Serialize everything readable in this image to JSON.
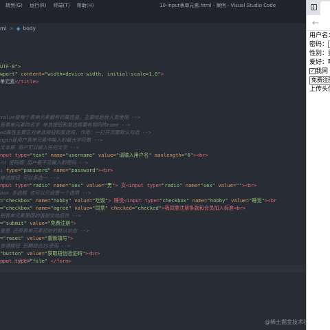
{
  "window": {
    "menu": [
      "转到(G)",
      "运行(R)",
      "终端(T)",
      "帮助(H)"
    ],
    "title": "10-input表单元素.html - 案例 - Visual Studio Code"
  },
  "breadcrumb": {
    "file": "ml",
    "separator": ">",
    "node": "body"
  },
  "code": {
    "l1": "UTF-8\">",
    "l2a": "wport\"",
    "l2b": "content=",
    "l2c": "\"width=device-width, initial-scale=1.0\"",
    "l2d": ">",
    "l3a": "单元素",
    "l3b": "</title>",
    "c1": "value是每个表单元素都有的属性值，主要给后台人员使用 -->",
    "c2": "是表单元素的名字 单选按钮和复选框要有相同的name -->",
    "c3": "ed属性主要正对单选按钮和复选框，作用：一打开页面默认勾选 -->",
    "c4": "ngth是用户表单元素中输入的最大字符数 -->",
    "c5": "文本框 用户可以输入任何文字 -->",
    "u1": "nput type=",
    "u2": "\"text\"",
    "u3": " name=",
    "u4": "\"username\"",
    "u5": " value=",
    "u6": "\"请输入用户名\"",
    "u7": " maxlength=",
    "u8": "\"6\"",
    "u9": "><br>",
    "c6": "rd 密码框 用户看不见输入的密码 -->",
    "p1": ": type=",
    "p2": "\"password\"",
    "p3": " name=",
    "p4": "\"password\"",
    "p5": "><br>",
    "c7": "单选按钮 可以多选一 -->",
    "r1": "nput type=",
    "r2": "\"radio\"",
    "r3": " name=",
    "r4": "\"sex\"",
    "r5": " value=",
    "r6": "\"男\"",
    "r7": "> 女<input type=",
    "r8": "\"radio\"",
    "r9": " name=",
    "r10": "\"sex\"",
    "r11": " value=",
    "r12": "\"\"",
    "r13": "><br>",
    "c8": "box 多选框 也可以只设置一个选项 -->",
    "k1": "=\"checkbox\"",
    "k2": " name=",
    "k3": "\"hobby\"",
    "k4": " value=",
    "k5": "\"吃饭\"",
    "k6": "> 睡觉<input type=",
    "k7": "\"checkbox\"",
    "k8": " name=",
    "k9": "\"hobby\"",
    "k10": " value=",
    "k11": "\"睡觉\"",
    "k12": "><br",
    "a1": "=\"checkbox\"",
    "a2": " name=",
    "a3": "\"agree\"",
    "a4": " value=",
    "a5": "\"同意\"",
    "a6": " checked=",
    "a7": "\"checked\"",
    "a8": ">我同意注册条款和会员加入标准<br>",
    "c9": "把表单元素里面的值提交给后台 -->",
    "s1": "=\"submit\"",
    "s2": " value=",
    "s3": "\"免费注册\"",
    "s4": ">",
    "c10": "重置 还原表单元素初始的默认状态 -->",
    "e1": "=\"reset\"",
    "e2": " value=",
    "e3": "\"重新填写\"",
    "e4": ">",
    "c11": "普通按钮 后期结合JS使用 -->",
    "b1": "\"button\"",
    "b2": " value=",
    "b3": "\"获取短信验证码\"",
    "b4": "><br>",
    "c12": "ype 上传文件 -->",
    "f1": "nput type=",
    "f2": "\"file\"",
    "f3": " </form>"
  },
  "browser": {
    "username_label": "用户名：",
    "password_label": "密码：",
    "sex_label": "性别：男",
    "hobby_label": "爱好：吃",
    "agree_label": "我同",
    "submit_label": "免费注册",
    "upload_label": "上传头像"
  },
  "watermark": "@稀土掘金技术社区"
}
